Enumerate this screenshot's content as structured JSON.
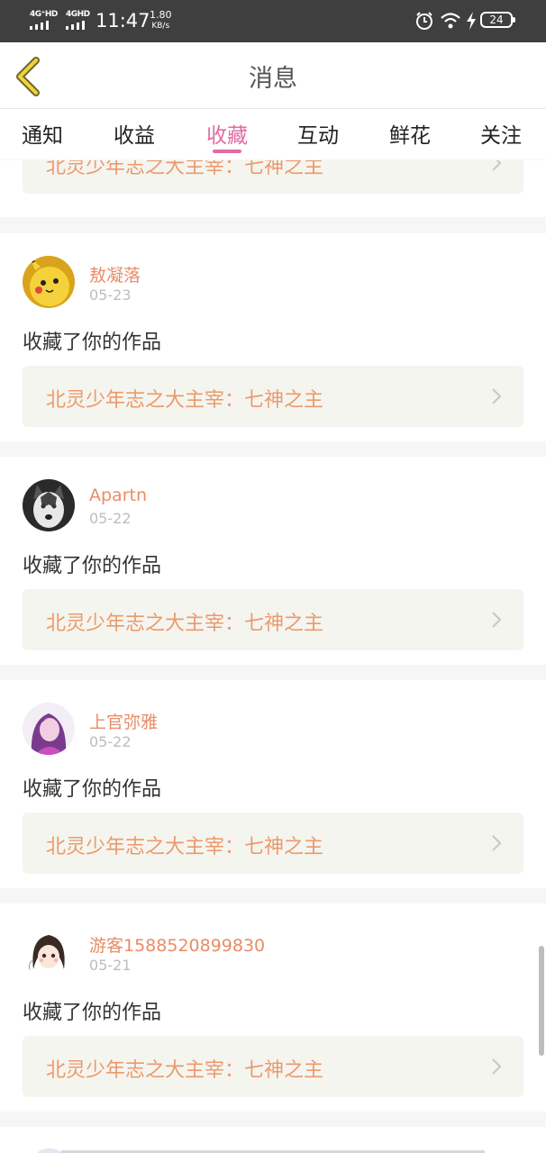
{
  "status_bar": {
    "net1": "4G⁺HD",
    "net2": "4GHD",
    "time": "11:47",
    "speed_value": "1.80",
    "speed_unit": "KB/s",
    "battery": "24",
    "icons": [
      "alarm-icon",
      "wifi-icon",
      "charging-icon",
      "battery-icon"
    ]
  },
  "header": {
    "back_icon": "chevron-left-icon",
    "title": "消息"
  },
  "tabs": [
    {
      "label": "通知"
    },
    {
      "label": "收益"
    },
    {
      "label": "收藏",
      "active": true
    },
    {
      "label": "互动"
    },
    {
      "label": "鲜花"
    },
    {
      "label": "关注"
    }
  ],
  "colors": {
    "accent": "#e06ca3",
    "username": "#e88c66",
    "work_title": "#eb9a6d",
    "work_bg": "#f5f5ef"
  },
  "partial_top_card": {
    "work_title": "北灵少年志之大主宰：七神之主"
  },
  "messages": [
    {
      "username": "敖凝落",
      "date": "05-23",
      "action": "收藏了你的作品",
      "work_title": "北灵少年志之大主宰：七神之主",
      "avatar": "pikachu-avatar"
    },
    {
      "username": "Apartn",
      "date": "05-22",
      "action": "收藏了你的作品",
      "work_title": "北灵少年志之大主宰：七神之主",
      "avatar": "husky-avatar"
    },
    {
      "username": "上官弥雅",
      "date": "05-22",
      "action": "收藏了你的作品",
      "work_title": "北灵少年志之大主宰：七神之主",
      "avatar": "girl-photo-avatar"
    },
    {
      "username": "游客1588520899830",
      "date": "05-21",
      "action": "收藏了你的作品",
      "work_title": "北灵少年志之大主宰：七神之主",
      "avatar": "anime-girl-avatar"
    }
  ]
}
